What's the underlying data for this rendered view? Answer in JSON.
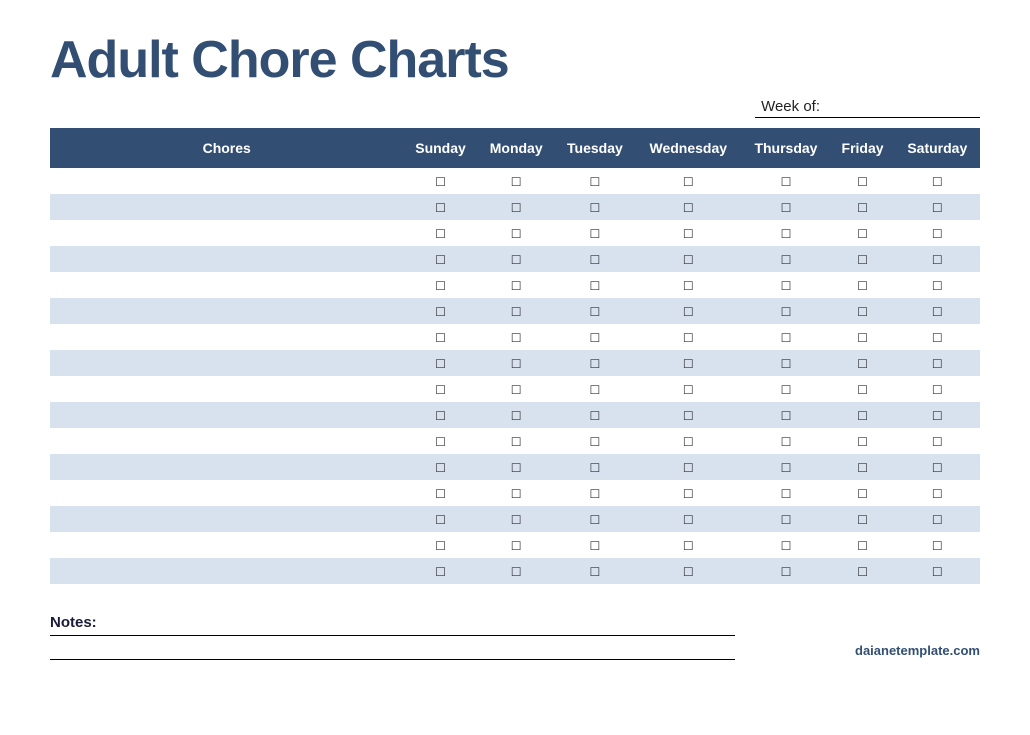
{
  "title": "Adult Chore Charts",
  "week_label": "Week of:",
  "columns": [
    "Chores",
    "Sunday",
    "Monday",
    "Tuesday",
    "Wednesday",
    "Thursday",
    "Friday",
    "Saturday"
  ],
  "row_count": 16,
  "checkbox_glyph": "☐",
  "notes_label": "Notes:",
  "credit": "daianetemplate.com"
}
